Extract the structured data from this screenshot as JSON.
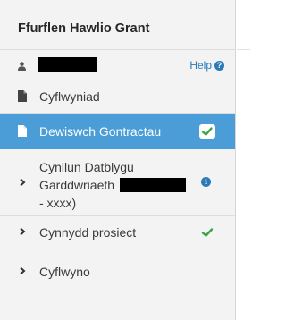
{
  "sidebar": {
    "title": "Ffurflen Hawlio Grant",
    "user": {
      "help_label": "Help",
      "help_icon": "?"
    },
    "items": [
      {
        "label": "Cyflwyniad",
        "icon": "document-icon"
      },
      {
        "label": "Dewiswch Gontractau",
        "icon": "check-icon",
        "active": true
      },
      {
        "label_line1": "Cynllun Datblygu",
        "label_line2": "Garddwriaeth",
        "label_line3": "- xxxx)",
        "icon": "info-icon",
        "info_glyph": "i"
      },
      {
        "label": "Cynnydd prosiect",
        "icon": "check-icon"
      },
      {
        "label": "Cyflwyno",
        "icon": "chevron-right-icon"
      }
    ]
  },
  "colors": {
    "active_bg": "#4a9dd6",
    "link": "#2a7ab8",
    "check_green": "#3aa547",
    "sidebar_bg": "#f3f3f3"
  }
}
